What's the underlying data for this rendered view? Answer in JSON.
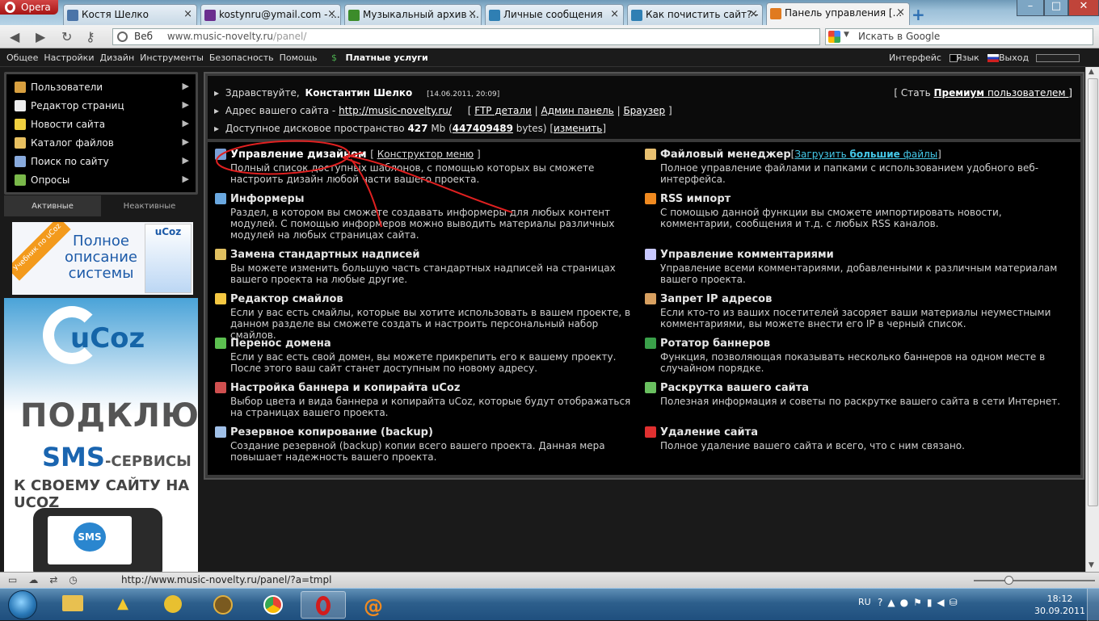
{
  "browser": {
    "opera_label": "Opera",
    "tabs": [
      {
        "label": "Костя Шелко",
        "color": "#4a74a8"
      },
      {
        "label": "kostynru@ymail.com - ...",
        "color": "#6b2e8f"
      },
      {
        "label": "Музыкальный архив ...",
        "color": "#3c8c2a"
      },
      {
        "label": "Личные сообщения",
        "color": "#2f7fb3"
      },
      {
        "label": "Как почистить сайт? - ...",
        "color": "#2f7fb3"
      },
      {
        "label": "Панель управления [...",
        "color": "#e07a1f"
      }
    ],
    "tab_close": "×",
    "new_tab": "+",
    "url_prefix": "Веб",
    "url_host": "www.music-novelty.ru",
    "url_path": "/panel/",
    "search_placeholder": "Искать в Google",
    "status_url": "http://www.music-novelty.ru/panel/?a=tmpl"
  },
  "topmenu": {
    "items": [
      "Общее",
      "Настройки",
      "Дизайн",
      "Инструменты",
      "Безопасность",
      "Помощь"
    ],
    "paid": "Платные услуги",
    "interface": "Интерфейс",
    "lang": "Язык",
    "logout": "Выход"
  },
  "leftmenu": {
    "items": [
      {
        "label": "Пользователи",
        "icon": "users-icon",
        "color": "#d8a040"
      },
      {
        "label": "Редактор страниц",
        "icon": "page-icon",
        "color": "#eeeeee"
      },
      {
        "label": "Новости сайта",
        "icon": "bulb-icon",
        "color": "#f0d040"
      },
      {
        "label": "Каталог файлов",
        "icon": "folder-icon",
        "color": "#e8c060"
      },
      {
        "label": "Поиск по сайту",
        "icon": "search-icon",
        "color": "#88aadd"
      },
      {
        "label": "Опросы",
        "icon": "chart-icon",
        "color": "#7ab84a"
      }
    ],
    "tabs": [
      "Активные",
      "Неактивные"
    ]
  },
  "banners": {
    "b1_ribbon": "Учебник по uCoz",
    "b1_text": "Полное описание системы",
    "b1_box": "uCoz",
    "b2_logo": "uCoz",
    "b2_line1": "ПОДКЛЮЧИ",
    "b2_line2": "SMS",
    "b2_line2b": "-СЕРВИСЫ",
    "b2_line3": "К СВОЕМУ САЙТУ НА UCOZ",
    "b2_sms": "SMS"
  },
  "info": {
    "hello": "Здравствуйте,",
    "user": "Константин Шелко",
    "date": "[14.06.2011, 20:09]",
    "premium_pre": "[ Стать",
    "premium": "Премиум",
    "premium_post": "пользователем ]",
    "addr_label": "Адрес вашего сайта -",
    "addr_url": "http://music-novelty.ru/",
    "ftp": "FTP детали",
    "admin": "Админ панель",
    "browser": "Браузер",
    "disk_label": "Доступное дисковое пространство",
    "disk_mb": "427",
    "disk_mb_unit": "Mb (",
    "disk_bytes": "447409489",
    "disk_bytes_unit": "bytes) [",
    "change": "изменить",
    "sep_open": "[",
    "sep_pipe": "|",
    "sep_close": "]"
  },
  "modules": [
    {
      "title": "Управление дизайном",
      "link": "Конструктор меню",
      "desc": "Полный список доступных шаблонов, с помощью которых вы сможете настроить дизайн любой части вашего проекта.",
      "icon": "design-icon",
      "color": "#7aa0d8"
    },
    {
      "title": "Файловый менеджер",
      "link_pre": "Загрузить",
      "link_bold": "большие",
      "link_post": "файлы",
      "desc": "Полное управление файлами и папками с использованием удобного веб-интерфейса.",
      "icon": "file-manager-icon",
      "color": "#e8c070"
    },
    {
      "title": "Информеры",
      "desc": "Раздел, в котором вы сможете создавать информеры для любых контент модулей. С помощью информеров можно выводить материалы различных модулей на любых страницах сайта.",
      "icon": "informer-icon",
      "color": "#6aa8e0"
    },
    {
      "title": "RSS импорт",
      "desc": "С помощью данной функции вы сможете импортировать новости, комментарии, сообщения и т.д. с любых RSS каналов.",
      "icon": "rss-icon",
      "color": "#f08a20"
    },
    {
      "title": "Замена стандартных надписей",
      "desc": "Вы можете изменить большую часть стандартных надписей на страницах вашего проекта на любые другие.",
      "icon": "labels-icon",
      "color": "#e0c060"
    },
    {
      "title": "Управление комментариями",
      "desc": "Управление всеми комментариями, добавленными к различным материалам вашего проекта.",
      "icon": "comments-icon",
      "color": "#c8c8ff"
    },
    {
      "title": "Редактор смайлов",
      "desc": "Если у вас есть смайлы, которые вы хотите использовать в вашем проекте, в данном разделе вы сможете создать и настроить персональный набор смайлов.",
      "icon": "smiley-icon",
      "color": "#f5c842"
    },
    {
      "title": "Запрет IP адресов",
      "desc": "Если кто-то из ваших посетителей засоряет ваши материалы неуместными комментариями, вы можете внести его IP в черный список.",
      "icon": "ban-ip-icon",
      "color": "#d8a060"
    },
    {
      "title": "Перенос домена",
      "desc": "Если у вас есть свой домен, вы можете прикрепить его к вашему проекту. После этого ваш сайт станет доступным по новому адресу.",
      "icon": "domain-icon",
      "color": "#5cc050"
    },
    {
      "title": "Ротатор баннеров",
      "desc": "Функция, позволяющая показывать несколько баннеров на одном месте в случайном порядке.",
      "icon": "banner-rotator-icon",
      "color": "#3aa04a"
    },
    {
      "title": "Настройка баннера и копирайта uCoz",
      "desc": "Выбор цвета и вида баннера и копирайта uCoz, которые будут отображаться на страницах вашего проекта.",
      "icon": "copyright-icon",
      "color": "#d05050"
    },
    {
      "title": "Раскрутка вашего сайта",
      "desc": "Полезная информация и советы по раскрутке вашего сайта в сети Интернет.",
      "icon": "promo-icon",
      "color": "#6ac060"
    },
    {
      "title": "Резервное копирование (backup)",
      "desc": "Создание резервной (backup) копии всего вашего проекта. Данная мера повышает надежность вашего проекта.",
      "icon": "backup-icon",
      "color": "#a0c0e8"
    },
    {
      "title": "Удаление сайта",
      "desc": "Полное удаление вашего сайта и всего, что с ним связано.",
      "icon": "delete-icon",
      "color": "#e03030"
    }
  ],
  "taskbar": {
    "lang": "RU",
    "time": "18:12",
    "date": "30.09.2011"
  },
  "colors": {
    "annotation": "#e02020",
    "accent_cyan": "#45c8e8"
  }
}
